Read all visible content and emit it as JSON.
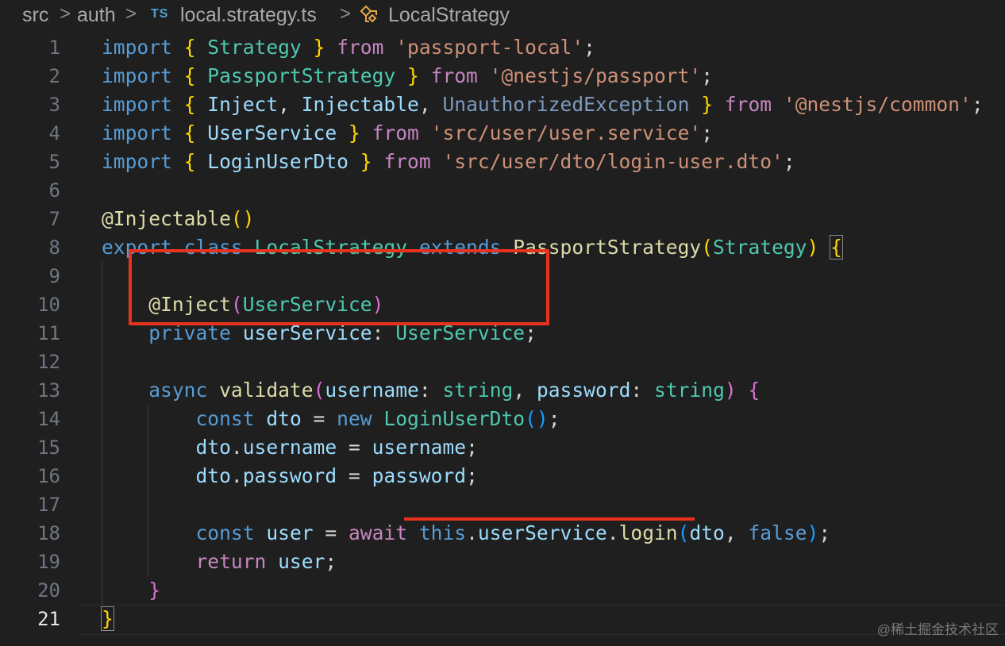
{
  "breadcrumb": {
    "items": [
      "src",
      "auth",
      "local.strategy.ts",
      "LocalStrategy"
    ],
    "file_badge": "TS",
    "separator": ">"
  },
  "editor": {
    "language": "TypeScript",
    "current_line": 21,
    "lines": [
      {
        "n": "1",
        "tokens": [
          [
            "kwb",
            "import"
          ],
          [
            "pl",
            " "
          ],
          [
            "br1",
            "{"
          ],
          [
            "pl",
            " "
          ],
          [
            "ty",
            "Strategy"
          ],
          [
            "pl",
            " "
          ],
          [
            "br1",
            "}"
          ],
          [
            "pl",
            " "
          ],
          [
            "kw",
            "from"
          ],
          [
            "pl",
            " "
          ],
          [
            "str",
            "'passport-local'"
          ],
          [
            "pl",
            ";"
          ]
        ]
      },
      {
        "n": "2",
        "tokens": [
          [
            "kwb",
            "import"
          ],
          [
            "pl",
            " "
          ],
          [
            "br1",
            "{"
          ],
          [
            "pl",
            " "
          ],
          [
            "ty",
            "PassportStrategy"
          ],
          [
            "pl",
            " "
          ],
          [
            "br1",
            "}"
          ],
          [
            "pl",
            " "
          ],
          [
            "kw",
            "from"
          ],
          [
            "pl",
            " "
          ],
          [
            "str",
            "'@nestjs/passport'"
          ],
          [
            "pl",
            ";"
          ]
        ]
      },
      {
        "n": "3",
        "tokens": [
          [
            "kwb",
            "import"
          ],
          [
            "pl",
            " "
          ],
          [
            "br1",
            "{"
          ],
          [
            "pl",
            " "
          ],
          [
            "id",
            "Inject"
          ],
          [
            "pl",
            ", "
          ],
          [
            "id",
            "Injectable"
          ],
          [
            "pl",
            ", "
          ],
          [
            "dim",
            "UnauthorizedException"
          ],
          [
            "pl",
            " "
          ],
          [
            "br1",
            "}"
          ],
          [
            "pl",
            " "
          ],
          [
            "kw",
            "from"
          ],
          [
            "pl",
            " "
          ],
          [
            "str",
            "'@nestjs/common'"
          ],
          [
            "pl",
            ";"
          ]
        ]
      },
      {
        "n": "4",
        "tokens": [
          [
            "kwb",
            "import"
          ],
          [
            "pl",
            " "
          ],
          [
            "br1",
            "{"
          ],
          [
            "pl",
            " "
          ],
          [
            "id",
            "UserService"
          ],
          [
            "pl",
            " "
          ],
          [
            "br1",
            "}"
          ],
          [
            "pl",
            " "
          ],
          [
            "kw",
            "from"
          ],
          [
            "pl",
            " "
          ],
          [
            "str",
            "'src/user/user.service'"
          ],
          [
            "pl",
            ";"
          ]
        ]
      },
      {
        "n": "5",
        "tokens": [
          [
            "kwb",
            "import"
          ],
          [
            "pl",
            " "
          ],
          [
            "br1",
            "{"
          ],
          [
            "pl",
            " "
          ],
          [
            "id",
            "LoginUserDto"
          ],
          [
            "pl",
            " "
          ],
          [
            "br1",
            "}"
          ],
          [
            "pl",
            " "
          ],
          [
            "kw",
            "from"
          ],
          [
            "pl",
            " "
          ],
          [
            "str",
            "'src/user/dto/login-user.dto'"
          ],
          [
            "pl",
            ";"
          ]
        ]
      },
      {
        "n": "6",
        "tokens": []
      },
      {
        "n": "7",
        "tokens": [
          [
            "fn",
            "@Injectable"
          ],
          [
            "br1",
            "()"
          ]
        ]
      },
      {
        "n": "8",
        "tokens": [
          [
            "kwb",
            "export"
          ],
          [
            "pl",
            " "
          ],
          [
            "kwb",
            "class"
          ],
          [
            "pl",
            " "
          ],
          [
            "ty",
            "LocalStrategy"
          ],
          [
            "pl",
            " "
          ],
          [
            "kwb",
            "extends"
          ],
          [
            "pl",
            " "
          ],
          [
            "fn",
            "PassportStrategy"
          ],
          [
            "br1",
            "("
          ],
          [
            "ty",
            "Strategy"
          ],
          [
            "br1",
            ")"
          ],
          [
            "pl",
            " "
          ],
          [
            "br1",
            "{"
          ]
        ]
      },
      {
        "n": "9",
        "tokens": []
      },
      {
        "n": "10",
        "indent": "    ",
        "tokens": [
          [
            "fn",
            "@Inject"
          ],
          [
            "br2",
            "("
          ],
          [
            "ty",
            "UserService"
          ],
          [
            "br2",
            ")"
          ]
        ]
      },
      {
        "n": "11",
        "indent": "    ",
        "tokens": [
          [
            "kwb",
            "private"
          ],
          [
            "pl",
            " "
          ],
          [
            "id",
            "userService"
          ],
          [
            "pl",
            ": "
          ],
          [
            "ty",
            "UserService"
          ],
          [
            "pl",
            ";"
          ]
        ]
      },
      {
        "n": "12",
        "tokens": []
      },
      {
        "n": "13",
        "indent": "    ",
        "tokens": [
          [
            "kwb",
            "async"
          ],
          [
            "pl",
            " "
          ],
          [
            "fn",
            "validate"
          ],
          [
            "br2",
            "("
          ],
          [
            "id",
            "username"
          ],
          [
            "pl",
            ": "
          ],
          [
            "ty",
            "string"
          ],
          [
            "pl",
            ", "
          ],
          [
            "id",
            "password"
          ],
          [
            "pl",
            ": "
          ],
          [
            "ty",
            "string"
          ],
          [
            "br2",
            ")"
          ],
          [
            "pl",
            " "
          ],
          [
            "br2",
            "{"
          ]
        ]
      },
      {
        "n": "14",
        "indent": "        ",
        "tokens": [
          [
            "kwb",
            "const"
          ],
          [
            "pl",
            " "
          ],
          [
            "id",
            "dto"
          ],
          [
            "pl",
            " = "
          ],
          [
            "kwb",
            "new"
          ],
          [
            "pl",
            " "
          ],
          [
            "ty",
            "LoginUserDto"
          ],
          [
            "br3",
            "()"
          ],
          [
            "pl",
            ";"
          ]
        ]
      },
      {
        "n": "15",
        "indent": "        ",
        "tokens": [
          [
            "id",
            "dto"
          ],
          [
            "pl",
            "."
          ],
          [
            "id",
            "username"
          ],
          [
            "pl",
            " = "
          ],
          [
            "id",
            "username"
          ],
          [
            "pl",
            ";"
          ]
        ]
      },
      {
        "n": "16",
        "indent": "        ",
        "tokens": [
          [
            "id",
            "dto"
          ],
          [
            "pl",
            "."
          ],
          [
            "id",
            "password"
          ],
          [
            "pl",
            " = "
          ],
          [
            "id",
            "password"
          ],
          [
            "pl",
            ";"
          ]
        ]
      },
      {
        "n": "17",
        "tokens": []
      },
      {
        "n": "18",
        "indent": "        ",
        "tokens": [
          [
            "kwb",
            "const"
          ],
          [
            "pl",
            " "
          ],
          [
            "id",
            "user"
          ],
          [
            "pl",
            " = "
          ],
          [
            "kw",
            "await"
          ],
          [
            "pl",
            " "
          ],
          [
            "kwb",
            "this"
          ],
          [
            "pl",
            "."
          ],
          [
            "id",
            "userService"
          ],
          [
            "pl",
            "."
          ],
          [
            "fn",
            "login"
          ],
          [
            "br3",
            "("
          ],
          [
            "id",
            "dto"
          ],
          [
            "pl",
            ", "
          ],
          [
            "kwb",
            "false"
          ],
          [
            "br3",
            ")"
          ],
          [
            "pl",
            ";"
          ]
        ]
      },
      {
        "n": "19",
        "indent": "        ",
        "tokens": [
          [
            "kw",
            "return"
          ],
          [
            "pl",
            " "
          ],
          [
            "id",
            "user"
          ],
          [
            "pl",
            ";"
          ]
        ]
      },
      {
        "n": "20",
        "indent": "    ",
        "tokens": [
          [
            "br2",
            "}"
          ]
        ]
      },
      {
        "n": "21",
        "tokens": [
          [
            "br1",
            "}"
          ]
        ]
      }
    ]
  },
  "watermark": "@稀土掘金技术社区",
  "colors": {
    "background": "#1f1f1f",
    "highlight": "#e8321e",
    "keyword": "#569cd6",
    "type": "#4ec9b0",
    "string": "#ce9178"
  }
}
